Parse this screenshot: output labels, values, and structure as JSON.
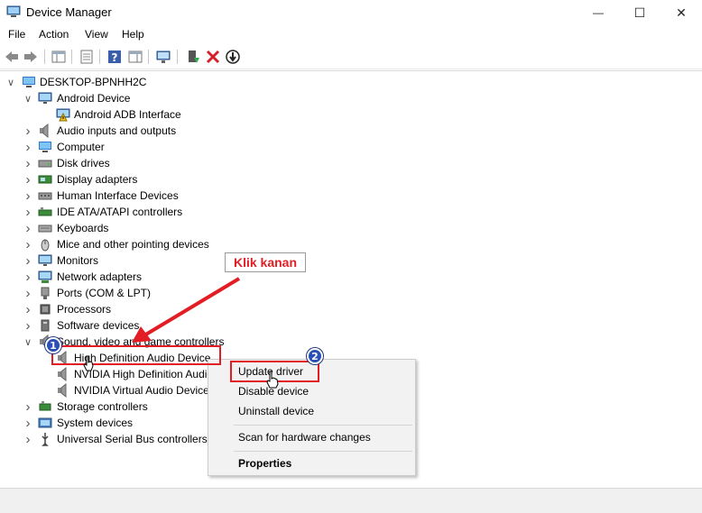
{
  "window": {
    "title": "Device Manager",
    "minimize_glyph": "—",
    "maximize_glyph": "☐",
    "close_glyph": "✕"
  },
  "menu": [
    "File",
    "Action",
    "View",
    "Help"
  ],
  "toolbar": {
    "icons": [
      "back-arrow-icon",
      "forward-arrow-icon",
      "show-hide-console-tree-icon",
      "properties-icon",
      "help-icon",
      "action-pane-icon",
      "monitor-scan-icon",
      "update-driver-icon",
      "uninstall-device-icon",
      "enable-device-icon"
    ]
  },
  "tree": {
    "root": "DESKTOP-BPNHH2C",
    "items": [
      {
        "label": "Android Device",
        "expanded": true,
        "icon": "monitor-icon"
      },
      {
        "label": "Android ADB Interface",
        "child": true,
        "icon": "warning-icon"
      },
      {
        "label": "Audio inputs and outputs",
        "icon": "speaker-icon"
      },
      {
        "label": "Computer",
        "icon": "computer-icon"
      },
      {
        "label": "Disk drives",
        "icon": "disk-drive-icon"
      },
      {
        "label": "Display adapters",
        "icon": "display-adapter-icon"
      },
      {
        "label": "Human Interface Devices",
        "icon": "hid-icon"
      },
      {
        "label": "IDE ATA/ATAPI controllers",
        "icon": "ide-controller-icon"
      },
      {
        "label": "Keyboards",
        "icon": "keyboard-icon"
      },
      {
        "label": "Mice and other pointing devices",
        "icon": "mouse-icon"
      },
      {
        "label": "Monitors",
        "icon": "monitor-icon"
      },
      {
        "label": "Network adapters",
        "icon": "network-adapter-icon"
      },
      {
        "label": "Ports (COM & LPT)",
        "icon": "port-icon"
      },
      {
        "label": "Processors",
        "icon": "processor-icon"
      },
      {
        "label": "Software devices",
        "icon": "software-device-icon"
      },
      {
        "label": "Sound, video and game controllers",
        "expanded": true,
        "icon": "speaker-icon"
      },
      {
        "label": "High Definition Audio Device",
        "child": true,
        "icon": "speaker-icon"
      },
      {
        "label": "NVIDIA High Definition Audio",
        "child": true,
        "icon": "speaker-icon"
      },
      {
        "label": "NVIDIA Virtual Audio Device",
        "child": true,
        "icon": "speaker-icon"
      },
      {
        "label": "Storage controllers",
        "icon": "storage-controller-icon"
      },
      {
        "label": "System devices",
        "icon": "system-device-icon"
      },
      {
        "label": "Universal Serial Bus controllers",
        "icon": "usb-icon"
      }
    ]
  },
  "context_menu": {
    "items": [
      "Update driver",
      "Disable device",
      "Uninstall device",
      "Scan for hardware changes",
      "Properties"
    ]
  },
  "annotations": {
    "callout_text": "Klik kanan",
    "badge_1": "1",
    "badge_2": "2",
    "highlight_color": "#e21d24",
    "badge_color": "#2a4fb5"
  }
}
